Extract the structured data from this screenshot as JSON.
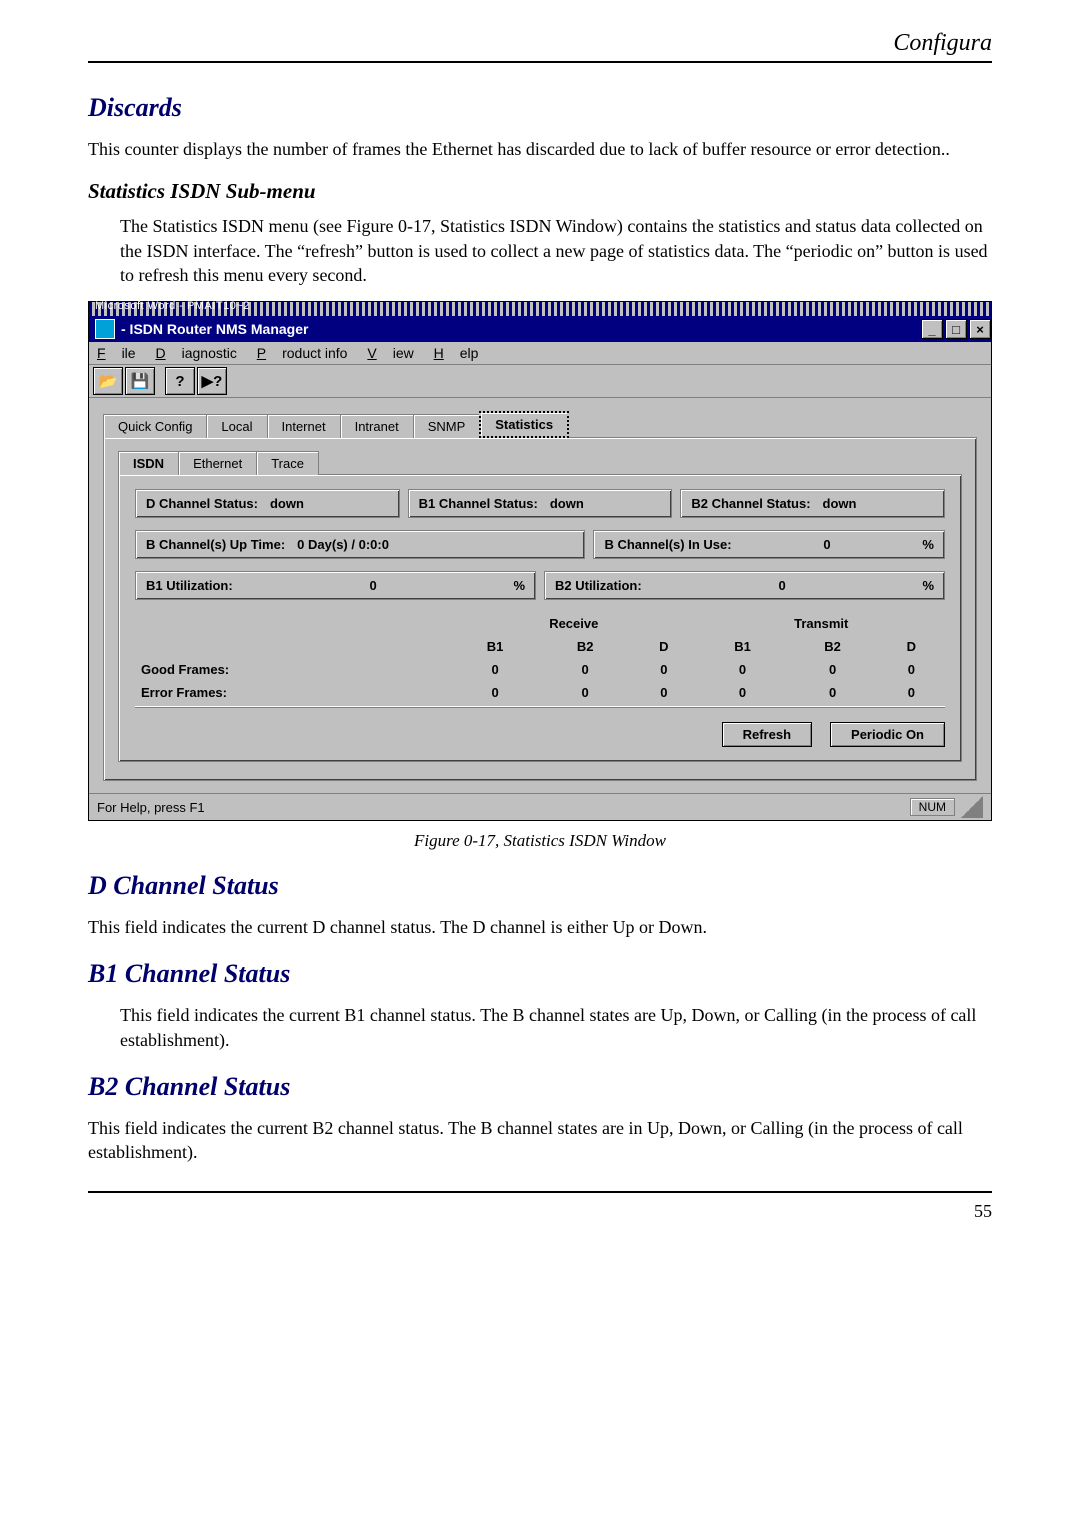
{
  "doc": {
    "running_head": "Configura",
    "h_discards": "Discards",
    "p_discards": "This counter displays the number of frames the Ethernet has discarded due to lack of buffer resource or error detection..",
    "h_stats_isdn": "Statistics ISDN Sub-menu",
    "p_stats_isdn": "The Statistics ISDN menu (see Figure 0-17, Statistics ISDN Window) contains the statistics and status data collected on the ISDN interface. The “refresh” button is used to collect a new page of statistics data. The “periodic on” button is used to refresh this menu every second.",
    "fig_caption": "Figure 0-17, Statistics ISDN Window",
    "h_dchan": "D Channel Status",
    "p_dchan": "This field indicates the current D channel status. The D channel is either Up or Down.",
    "h_b1": "B1 Channel Status",
    "p_b1": "This field indicates the current B1 channel status. The B channel states are Up, Down, or Calling (in the process of call establishment).",
    "h_b2": "B2 Channel Status",
    "p_b2": "This field indicates the current B2 channel status. The B channel states are in Up, Down, or Calling (in the process of call establishment).",
    "page_no": "55"
  },
  "app": {
    "micro_title": "Microsoft Word - PMAIT10~2",
    "title": " - ISDN Router NMS Manager",
    "win_min": "_",
    "win_max": "□",
    "win_close": "×",
    "menu": [
      "File",
      "Diagnostic",
      "Product info",
      "View",
      "Help"
    ],
    "tabs1": [
      "Quick Config",
      "Local",
      "Internet",
      "Intranet",
      "SNMP",
      "Statistics"
    ],
    "tabs1_active": 5,
    "tabs2": [
      "ISDN",
      "Ethernet",
      "Trace"
    ],
    "tabs2_active": 0,
    "d_label": "D Channel Status:",
    "d_val": "down",
    "b1c_label": "B1 Channel Status:",
    "b1c_val": "down",
    "b2c_label": "B2 Channel Status:",
    "b2c_val": "down",
    "up_label": "B Channel(s)  Up Time:",
    "up_val": "0 Day(s) / 0:0:0",
    "inuse_label": "B Channel(s) In Use:",
    "inuse_val": "0",
    "inuse_unit": "%",
    "b1u_label": "B1 Utilization:",
    "b1u_val": "0",
    "b1u_unit": "%",
    "b2u_label": "B2 Utilization:",
    "b2u_val": "0",
    "b2u_unit": "%",
    "rx": "Receive",
    "tx": "Transmit",
    "cols": [
      "B1",
      "B2",
      "D",
      "B1",
      "B2",
      "D"
    ],
    "rows": [
      {
        "lbl": "Good Frames:",
        "v": [
          "0",
          "0",
          "0",
          "0",
          "0",
          "0"
        ]
      },
      {
        "lbl": "Error Frames:",
        "v": [
          "0",
          "0",
          "0",
          "0",
          "0",
          "0"
        ]
      }
    ],
    "refresh": "Refresh",
    "periodic": "Periodic On",
    "status": "For Help, press F1",
    "num": "NUM"
  }
}
